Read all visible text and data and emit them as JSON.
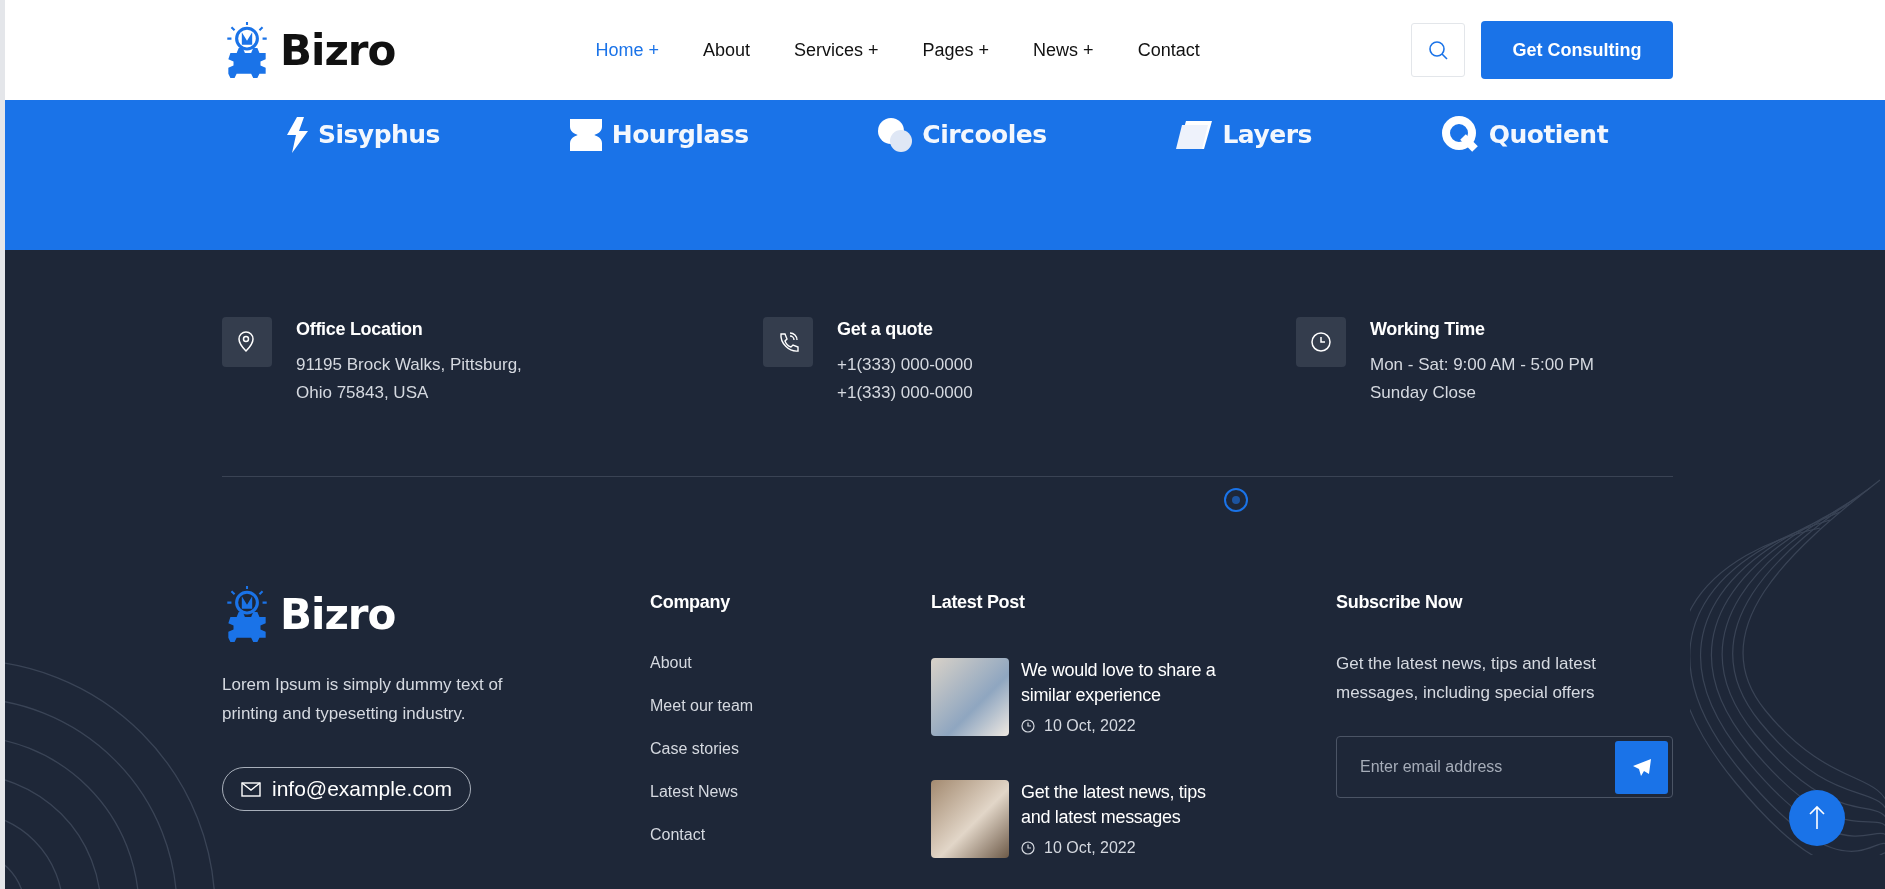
{
  "header": {
    "logo": "Bizro",
    "nav": [
      {
        "label": "Home",
        "marker": "+",
        "selected": true
      },
      {
        "label": "About",
        "selected": false
      },
      {
        "label": "Services",
        "marker": "+",
        "selected": false
      },
      {
        "label": "Pages",
        "marker": "+",
        "selected": false
      },
      {
        "label": "News",
        "marker": "+",
        "selected": false
      },
      {
        "label": "Contact",
        "selected": false
      }
    ],
    "cta": "Get Consulting"
  },
  "partners": [
    {
      "name": "Sisyphus",
      "kind": "bolt"
    },
    {
      "name": "Hourglass",
      "kind": "hourglass"
    },
    {
      "name": "Circooles",
      "kind": "circles"
    },
    {
      "name": "Layers",
      "kind": "layers"
    },
    {
      "name": "Quotient",
      "kind": "q"
    }
  ],
  "contact_info": [
    {
      "kind": "location",
      "title": "Office Location",
      "lines": [
        "91195 Brock Walks, Pittsburg,",
        "Ohio 75843, USA"
      ]
    },
    {
      "kind": "phone",
      "title": "Get a quote",
      "lines": [
        "+1(333) 000-0000",
        "+1(333) 000-0000"
      ]
    },
    {
      "kind": "clock",
      "title": "Working Time",
      "lines": [
        "Mon - Sat: 9:00 AM - 5:00 PM",
        "Sunday Close"
      ]
    }
  ],
  "footer": {
    "brand": {
      "logo": "Bizro",
      "description": "Lorem Ipsum is simply dummy text of printing and typesetting industry.",
      "email": "info@example.com"
    },
    "company": {
      "title": "Company",
      "links": [
        "About",
        "Meet our team",
        "Case stories",
        "Latest News",
        "Contact"
      ]
    },
    "latest_post": {
      "title": "Latest Post",
      "posts": [
        {
          "title": "We would love to share a similar experience",
          "date": "10 Oct, 2022"
        },
        {
          "title": "Get the latest news, tips and latest messages",
          "date": "10 Oct, 2022"
        }
      ]
    },
    "subscribe": {
      "title": "Subscribe Now",
      "text": "Get the latest news, tips and latest messages, including special offers",
      "placeholder": "Enter email address"
    }
  }
}
